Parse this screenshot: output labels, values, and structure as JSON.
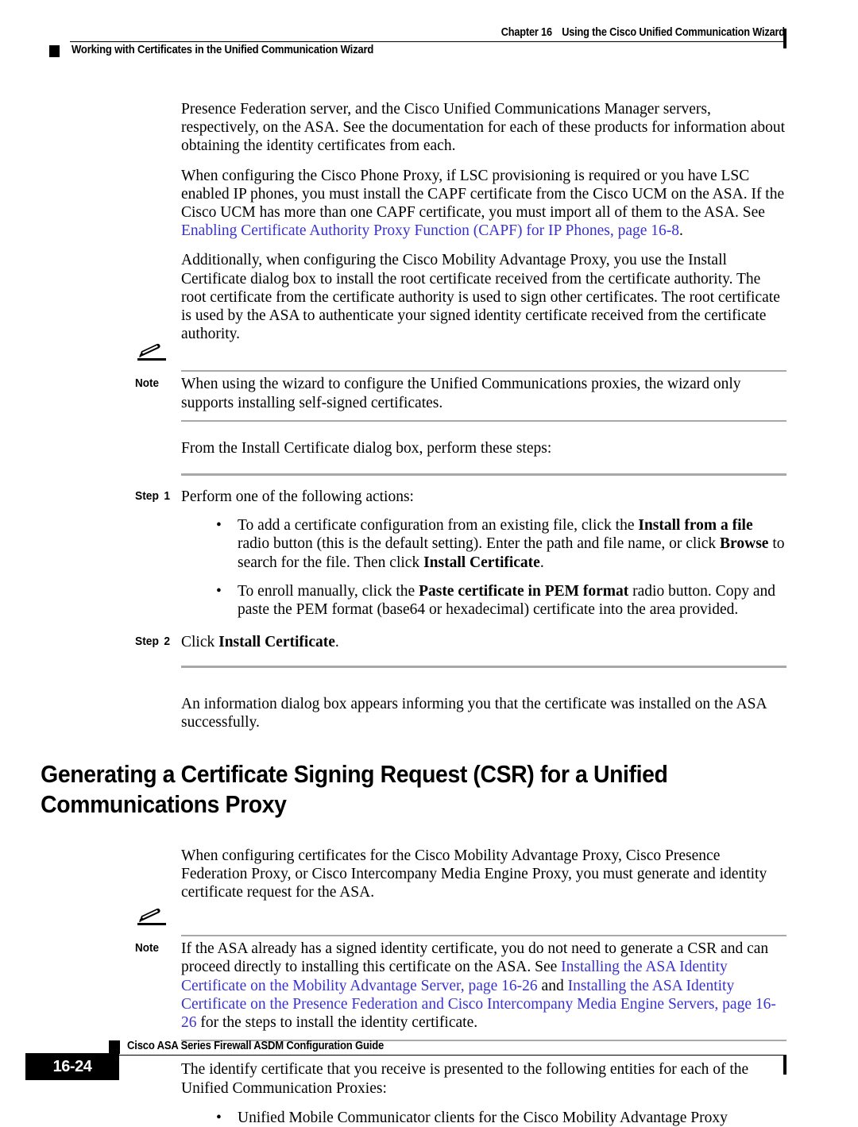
{
  "header": {
    "chapter_label": "Chapter 16",
    "chapter_title": "Using the Cisco Unified Communication Wizard",
    "section_subtitle": "Working with Certificates in the Unified Communication Wizard"
  },
  "body": {
    "para1": "Presence Federation server, and the Cisco Unified Communications Manager servers, respectively, on the ASA. See the documentation for each of these products for information about obtaining the identity certificates from each.",
    "para2_pre": "When configuring the Cisco Phone Proxy, if LSC provisioning is required or you have LSC enabled IP phones, you must install the CAPF certificate from the Cisco UCM on the ASA. If the Cisco UCM has more than one CAPF certificate, you must import all of them to the ASA. See ",
    "para2_link": "Enabling Certificate Authority Proxy Function (CAPF) for IP Phones, page 16-8",
    "para2_post": ".",
    "para3": "Additionally, when configuring the Cisco Mobility Advantage Proxy, you use the Install Certificate dialog box to install the root certificate received from the certificate authority. The root certificate from the certificate authority is used to sign other certificates. The root certificate is used by the ASA to authenticate your signed identity certificate received from the certificate authority.",
    "para4": "From the Install Certificate dialog box, perform these steps:",
    "para5": "An information dialog box appears informing you that the certificate was installed on the ASA successfully.",
    "para6": "When configuring certificates for the Cisco Mobility Advantage Proxy, Cisco Presence Federation Proxy, or Cisco Intercompany Media Engine Proxy, you must generate and identity certificate request for the ASA.",
    "para7": "The identify certificate that you receive is presented to the following entities for each of the Unified Communication Proxies:"
  },
  "note1": {
    "label": "Note",
    "icon": "pencil-icon",
    "text": "When using the wizard to configure the Unified Communications proxies, the wizard only supports installing self-signed certificates."
  },
  "note2": {
    "label": "Note",
    "icon": "pencil-icon",
    "text_pre": "If the ASA already has a signed identity certificate, you do not need to generate a CSR and can proceed directly to installing this certificate on the ASA. See ",
    "link1": "Installing the ASA Identity Certificate on the Mobility Advantage Server, page 16-26",
    "mid": " and ",
    "link2": "Installing the ASA Identity Certificate on the Presence Federation and Cisco Intercompany Media Engine Servers, page 16-26",
    "text_post": " for the steps to install the identity certificate."
  },
  "steps": {
    "step1": {
      "label": "Step",
      "number": "1",
      "text": "Perform one of the following actions:",
      "bullets": [
        {
          "seg1": "To add a certificate configuration from an existing file, click the ",
          "bold1": "Install from a file",
          "seg2": " radio button (this is the default setting). Enter the path and file name, or click ",
          "bold2": "Browse",
          "seg3": " to search for the file. Then click ",
          "bold3": "Install Certificate",
          "seg4": "."
        },
        {
          "seg1": "To enroll manually, click the ",
          "bold1": "Paste certificate in PEM format",
          "seg2": " radio button. Copy and paste the PEM format (base64 or hexadecimal) certificate into the area provided.",
          "bold2": "",
          "seg3": "",
          "bold3": "",
          "seg4": ""
        }
      ]
    },
    "step2": {
      "label": "Step",
      "number": "2",
      "text_pre": "Click ",
      "bold": "Install Certificate",
      "text_post": "."
    }
  },
  "section_heading": "Generating a Certificate Signing Request (CSR) for a Unified Communications Proxy",
  "final_bullets": [
    "Unified Mobile Communicator clients for the Cisco Mobility Advantage Proxy"
  ],
  "bullet_glyph": "•",
  "footer": {
    "guide_title": "Cisco ASA Series Firewall ASDM Configuration Guide",
    "page_number": "16-24"
  },
  "colors": {
    "link": "#3a32cd",
    "rule_gray": "#a8a8a8",
    "black": "#000000"
  }
}
